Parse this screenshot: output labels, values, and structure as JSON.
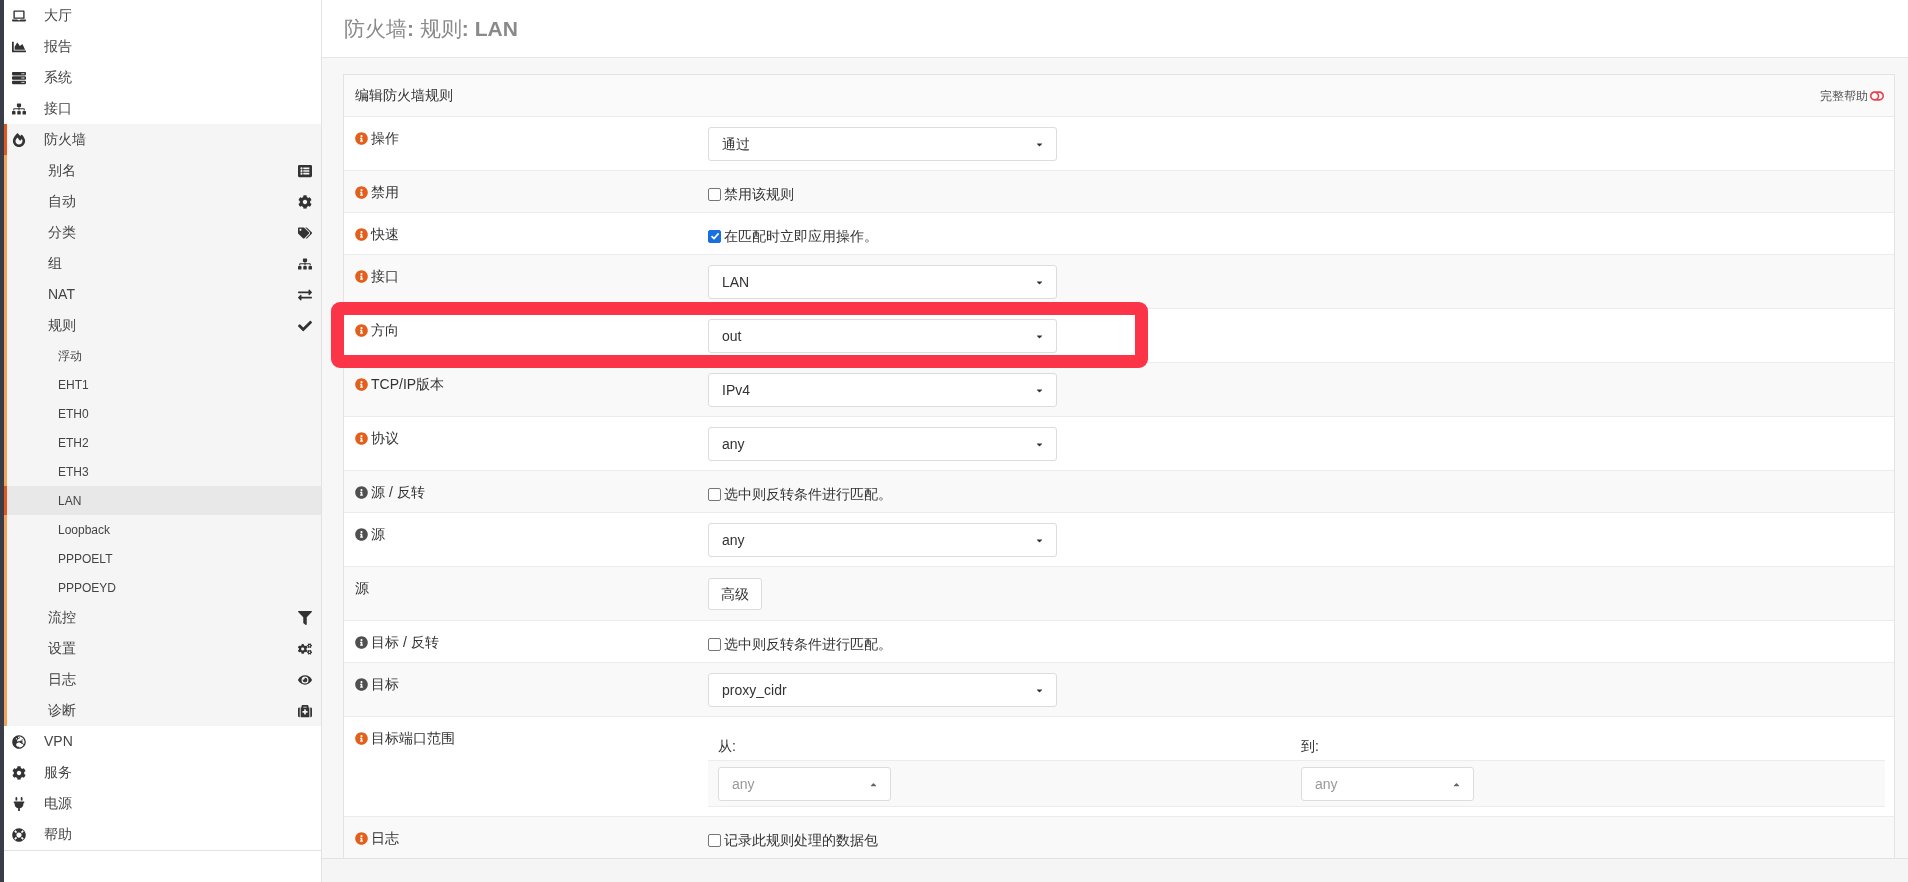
{
  "sidebar": {
    "items": [
      {
        "label": "大厅",
        "selected": false
      },
      {
        "label": "报告",
        "selected": false
      },
      {
        "label": "系统",
        "selected": false
      },
      {
        "label": "接口",
        "selected": false
      },
      {
        "label": "防火墙",
        "selected": false,
        "expanded": true,
        "children": [
          {
            "label": "别名",
            "selected": false
          },
          {
            "label": "自动",
            "selected": false
          },
          {
            "label": "分类",
            "selected": false
          },
          {
            "label": "组",
            "selected": false
          },
          {
            "label": "NAT",
            "selected": false
          },
          {
            "label": "规则",
            "selected": false,
            "expanded": true,
            "children": [
              {
                "label": "浮动",
                "selected": false
              },
              {
                "label": "EHT1",
                "selected": false
              },
              {
                "label": "ETH0",
                "selected": false
              },
              {
                "label": "ETH2",
                "selected": false
              },
              {
                "label": "ETH3",
                "selected": false
              },
              {
                "label": "LAN",
                "selected": true
              },
              {
                "label": "Loopback",
                "selected": false
              },
              {
                "label": "PPPOELT",
                "selected": false
              },
              {
                "label": "PPPOEYD",
                "selected": false
              }
            ]
          },
          {
            "label": "流控",
            "selected": false
          },
          {
            "label": "设置",
            "selected": false
          },
          {
            "label": "日志",
            "selected": false
          },
          {
            "label": "诊断",
            "selected": false
          }
        ]
      },
      {
        "label": "VPN",
        "selected": false
      },
      {
        "label": "服务",
        "selected": false
      },
      {
        "label": "电源",
        "selected": false
      },
      {
        "label": "帮助",
        "selected": false
      }
    ]
  },
  "page_title": "防火墙**:** 规则**:** **LAN**",
  "panel": {
    "title": "编辑防火墙规则",
    "full_help": {
      "label": "完整帮助",
      "on": false
    },
    "rows": [
      {
        "label": "操作",
        "color": "#e35f1c",
        "highlighted": false,
        "kind": "select",
        "value": "通过"
      },
      {
        "label": "禁用",
        "color": "#e35f1c",
        "highlighted": false,
        "kind": "checkbox",
        "checked": false,
        "text": "禁用该规则"
      },
      {
        "label": "快速",
        "color": "#e35f1c",
        "highlighted": false,
        "kind": "checkbox",
        "checked": true,
        "text": "在匹配时立即应用操作。"
      },
      {
        "label": "接口",
        "color": "#e35f1c",
        "highlighted": false,
        "kind": "select",
        "value": "LAN"
      },
      {
        "label": "方向",
        "color": "#e35f1c",
        "highlighted": true,
        "kind": "select",
        "value": "out"
      },
      {
        "label": "TCP/IP版本",
        "color": "#e35f1c",
        "highlighted": false,
        "kind": "select",
        "value": "IPv4"
      },
      {
        "label": "协议",
        "color": "#e35f1c",
        "highlighted": false,
        "kind": "select",
        "value": "any"
      },
      {
        "label": "源 / 反转",
        "color": "#505050",
        "highlighted": false,
        "kind": "checkbox",
        "checked": false,
        "text": "选中则反转条件进行匹配。"
      },
      {
        "label": "源",
        "color": "#505050",
        "highlighted": false,
        "kind": "select",
        "value": "any"
      },
      {
        "label": "源",
        "highlighted": false,
        "kind": "button",
        "text": "高级"
      },
      {
        "label": "目标 / 反转",
        "color": "#505050",
        "highlighted": false,
        "kind": "checkbox",
        "checked": false,
        "text": "选中则反转条件进行匹配。"
      },
      {
        "label": "目标",
        "color": "#505050",
        "highlighted": false,
        "kind": "select",
        "value": "proxy_cidr"
      },
      {
        "label": "目标端口范围",
        "color": "#e35f1c",
        "highlighted": false,
        "kind": "port_range",
        "from": {
          "label": "从:",
          "placeholder": "any"
        },
        "to": {
          "label": "到:",
          "placeholder": "any"
        }
      },
      {
        "label": "日志",
        "color": "#e35f1c",
        "highlighted": false,
        "kind": "checkbox",
        "checked": false,
        "text": "记录此规则处理的数据包"
      }
    ]
  }
}
